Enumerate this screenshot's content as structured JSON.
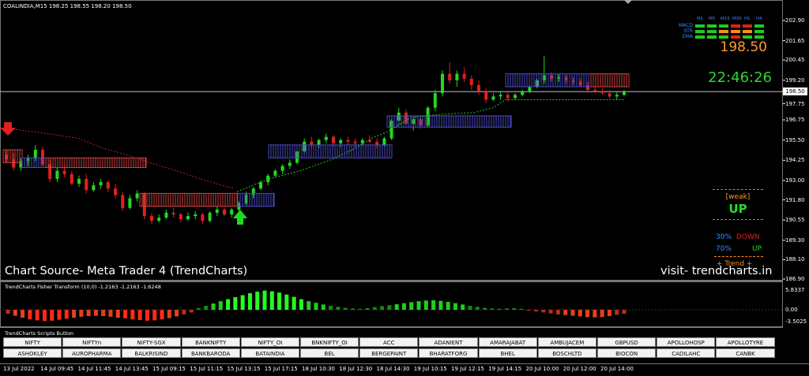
{
  "header": {
    "symbol_info": "COALINDIA,M15  198.25 198.55 198.20 198.50"
  },
  "price_axis": {
    "labels": [
      "202.90",
      "201.65",
      "200.45",
      "199.20",
      "197.75",
      "196.75",
      "195.50",
      "194.25",
      "193.00",
      "191.80",
      "190.55",
      "189.30",
      "188.10",
      "186.90"
    ],
    "current_price": "198.50"
  },
  "sub_axis": {
    "labels": [
      "5.8337",
      "0.00",
      "-3.5025"
    ]
  },
  "dashboard": {
    "timeframes": [
      "M1",
      "M5",
      "M15",
      "M30",
      "H1",
      "H4"
    ],
    "indicators": [
      "MACD",
      "STR",
      "EMA"
    ],
    "price": "198.50",
    "clock": "22:46:26",
    "strength": "[weak]",
    "direction": "UP",
    "down_pct": "30%",
    "down_label": "DOWN",
    "up_pct": "70%",
    "up_label": "UP",
    "trend_label": "+ Trend +",
    "colors": {
      "up": "#22c922",
      "down": "#e02020",
      "neutral": "#ff8c1a"
    }
  },
  "watermarks": {
    "source": "Chart Source- Meta Trader 4 (TrendCharts)",
    "visit": "visit- trendcharts.in"
  },
  "fisher": {
    "title": "TrendCharts Fisher Transform (10,0) -1.2163 -1.2163 -1.6248"
  },
  "scripts": {
    "title": "TrendCharts Scripts Button",
    "row1": [
      "NIFTY",
      "NIFTYn",
      "NIFTY-SGX",
      "BANKNIFTY",
      "NIFTY_OI",
      "BNKNIFTY_OI",
      "ACC",
      "ADANIENT",
      "AMARAJABAT",
      "AMBUJACEM",
      "GBPUSD",
      "APOLLOHOSP",
      "APOLLOTYRE"
    ],
    "row2": [
      "ASHOKLEY",
      "AUROPHARMA",
      "BALKRISIND",
      "BANKBARODA",
      "BATAINDIA",
      "BEL",
      "BERGEPAINT",
      "BHARATFORG",
      "BHEL",
      "BOSCHLTD",
      "BIOCON",
      "CADILAHC",
      "CANBK"
    ]
  },
  "time_axis": [
    "13 Jul 2022",
    "14 Jul 09:45",
    "14 Jul 11:45",
    "14 Jul 13:45",
    "15 Jul 09:15",
    "15 Jul 11:15",
    "15 Jul 13:15",
    "15 Jul 17:15",
    "18 Jul 10:30",
    "18 Jul 12:30",
    "18 Jul 14:30",
    "19 Jul 10:15",
    "19 Jul 12:15",
    "19 Jul 14:15",
    "20 Jul 10:00",
    "20 Jul 12:00",
    "20 Jul 14:00"
  ],
  "chart_data": {
    "type": "candlestick",
    "symbol": "COALINDIA",
    "timeframe": "M15",
    "ylim": [
      186.9,
      202.9
    ],
    "candles": [
      [
        194.6,
        194.9,
        194.1,
        194.3
      ],
      [
        194.3,
        194.7,
        193.6,
        193.8
      ],
      [
        193.8,
        194.4,
        193.6,
        194.2
      ],
      [
        194.2,
        194.6,
        193.9,
        194.4
      ],
      [
        194.4,
        195.2,
        194.2,
        194.9
      ],
      [
        194.9,
        195.1,
        193.9,
        194.0
      ],
      [
        194.0,
        194.3,
        192.9,
        193.1
      ],
      [
        193.1,
        193.8,
        192.9,
        193.6
      ],
      [
        193.6,
        193.9,
        193.2,
        193.4
      ],
      [
        193.4,
        193.6,
        192.7,
        192.8
      ],
      [
        192.8,
        193.3,
        192.6,
        193.1
      ],
      [
        193.1,
        193.4,
        192.2,
        192.4
      ],
      [
        192.4,
        192.9,
        192.3,
        192.7
      ],
      [
        192.7,
        193.1,
        192.5,
        192.9
      ],
      [
        192.9,
        193.0,
        192.3,
        192.5
      ],
      [
        192.5,
        192.8,
        191.9,
        192.1
      ],
      [
        192.1,
        192.3,
        191.1,
        191.3
      ],
      [
        191.3,
        192.1,
        191.2,
        191.9
      ],
      [
        191.9,
        192.4,
        191.7,
        192.2
      ],
      [
        192.2,
        192.3,
        190.6,
        190.8
      ],
      [
        190.8,
        191.0,
        190.3,
        190.5
      ],
      [
        190.5,
        190.9,
        190.4,
        190.7
      ],
      [
        190.7,
        191.2,
        190.6,
        191.0
      ],
      [
        191.0,
        191.3,
        190.7,
        190.9
      ],
      [
        190.9,
        191.0,
        190.4,
        190.6
      ],
      [
        190.6,
        191.0,
        190.5,
        190.8
      ],
      [
        190.8,
        191.1,
        190.6,
        190.9
      ],
      [
        190.9,
        191.0,
        190.3,
        190.5
      ],
      [
        190.5,
        191.1,
        190.4,
        191.0
      ],
      [
        191.0,
        191.4,
        190.8,
        191.2
      ],
      [
        191.2,
        191.3,
        190.8,
        190.9
      ],
      [
        190.9,
        191.3,
        190.7,
        191.2
      ],
      [
        191.2,
        191.7,
        191.1,
        191.6
      ],
      [
        191.6,
        192.3,
        191.5,
        192.1
      ],
      [
        192.1,
        192.6,
        191.9,
        192.5
      ],
      [
        192.5,
        193.0,
        192.4,
        192.9
      ],
      [
        192.9,
        193.4,
        192.7,
        193.3
      ],
      [
        193.3,
        193.7,
        193.2,
        193.6
      ],
      [
        193.6,
        194.0,
        193.4,
        193.9
      ],
      [
        193.9,
        194.3,
        193.7,
        194.1
      ],
      [
        194.1,
        194.9,
        194.0,
        194.8
      ],
      [
        194.8,
        195.6,
        194.6,
        195.4
      ],
      [
        195.4,
        195.7,
        195.0,
        195.2
      ],
      [
        195.2,
        195.6,
        195.0,
        195.5
      ],
      [
        195.5,
        195.9,
        195.3,
        195.7
      ],
      [
        195.7,
        195.8,
        195.1,
        195.3
      ],
      [
        195.3,
        195.6,
        195.1,
        195.5
      ],
      [
        195.5,
        195.7,
        195.2,
        195.4
      ],
      [
        195.4,
        195.6,
        195.1,
        195.3
      ],
      [
        195.3,
        195.6,
        195.2,
        195.5
      ],
      [
        195.5,
        195.8,
        195.3,
        195.4
      ],
      [
        195.4,
        195.6,
        195.0,
        195.2
      ],
      [
        195.2,
        195.7,
        195.1,
        195.6
      ],
      [
        195.6,
        196.8,
        195.5,
        196.7
      ],
      [
        196.7,
        197.5,
        196.4,
        197.2
      ],
      [
        197.2,
        197.4,
        196.3,
        196.5
      ],
      [
        196.5,
        196.9,
        196.1,
        196.8
      ],
      [
        196.8,
        197.0,
        196.2,
        196.4
      ],
      [
        196.4,
        197.6,
        196.3,
        197.5
      ],
      [
        197.5,
        198.6,
        197.3,
        198.4
      ],
      [
        198.4,
        199.8,
        198.2,
        199.6
      ],
      [
        199.6,
        200.3,
        199.0,
        199.2
      ],
      [
        199.2,
        199.8,
        198.8,
        199.6
      ],
      [
        199.6,
        200.0,
        199.1,
        199.3
      ],
      [
        199.3,
        199.5,
        198.6,
        198.9
      ],
      [
        198.9,
        199.2,
        198.3,
        198.5
      ],
      [
        198.5,
        198.7,
        197.8,
        198.0
      ],
      [
        198.0,
        198.4,
        197.9,
        198.2
      ],
      [
        198.2,
        198.5,
        198.0,
        198.3
      ],
      [
        198.3,
        198.5,
        197.9,
        198.1
      ],
      [
        198.1,
        198.4,
        198.0,
        198.3
      ],
      [
        198.3,
        198.6,
        198.2,
        198.5
      ],
      [
        198.5,
        198.9,
        198.4,
        198.8
      ],
      [
        198.8,
        199.3,
        198.7,
        199.2
      ],
      [
        199.2,
        200.7,
        199.0,
        199.5
      ],
      [
        199.5,
        199.7,
        199.1,
        199.3
      ],
      [
        199.3,
        199.6,
        199.1,
        199.4
      ],
      [
        199.4,
        199.5,
        199.0,
        199.2
      ],
      [
        199.2,
        199.4,
        198.9,
        199.1
      ],
      [
        199.1,
        199.3,
        198.8,
        198.9
      ],
      [
        198.9,
        199.1,
        198.5,
        198.6
      ],
      [
        198.6,
        198.8,
        198.4,
        198.5
      ],
      [
        198.5,
        198.7,
        198.3,
        198.4
      ],
      [
        198.4,
        198.6,
        198.1,
        198.2
      ],
      [
        198.2,
        198.5,
        198.0,
        198.3
      ],
      [
        198.3,
        198.6,
        198.2,
        198.5
      ]
    ],
    "fisher_histogram": [
      -1.2,
      -1.8,
      -2.4,
      -2.9,
      -3.2,
      -3.4,
      -3.3,
      -3.0,
      -2.7,
      -2.4,
      -2.1,
      -1.9,
      -1.8,
      -1.9,
      -2.1,
      -2.4,
      -2.6,
      -2.9,
      -3.1,
      -3.3,
      -3.2,
      -2.9,
      -2.5,
      -2.0,
      -1.4,
      -0.8,
      0.5,
      1.2,
      1.9,
      2.6,
      3.2,
      3.8,
      4.4,
      5.0,
      5.5,
      5.8,
      5.6,
      5.2,
      4.6,
      3.9,
      3.2,
      2.6,
      2.1,
      1.6,
      1.2,
      0.9,
      0.6,
      0.4,
      0.3,
      0.5,
      0.8,
      1.1,
      1.4,
      1.7,
      2.0,
      2.3,
      2.6,
      2.8,
      2.9,
      2.7,
      2.4,
      2.0,
      1.6,
      1.2,
      0.9,
      0.6,
      0.4,
      0.3,
      0.4,
      0.5,
      0.3,
      -0.2,
      -0.5,
      -0.8,
      -1.1,
      -1.4,
      -1.6,
      -1.8,
      -2.0,
      -2.2,
      -2.3,
      -2.2,
      -1.9,
      -1.5,
      -1.2
    ]
  }
}
